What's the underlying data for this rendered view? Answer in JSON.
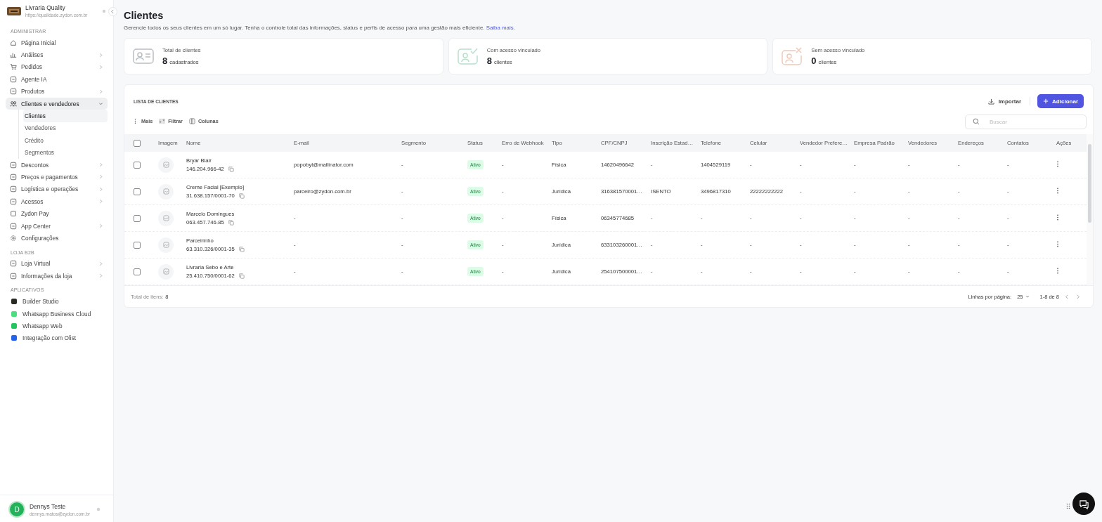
{
  "store": {
    "name": "Livraria Quality",
    "url": "https://qualidade.zydon.com.br"
  },
  "sidebar": {
    "sections": [
      {
        "title": "ADMINISTRAR",
        "items": [
          {
            "kind": "nav",
            "label": "Página Inicial",
            "has_submenu": false
          },
          {
            "kind": "nav",
            "label": "Análises",
            "has_submenu": true,
            "expanded": false
          },
          {
            "kind": "nav",
            "label": "Pedidos",
            "has_submenu": true,
            "expanded": false
          },
          {
            "kind": "nav",
            "label": "Agente IA",
            "has_submenu": false
          },
          {
            "kind": "nav",
            "label": "Produtos",
            "has_submenu": true,
            "expanded": false
          },
          {
            "kind": "nav",
            "label": "Clientes e vendedores",
            "has_submenu": true,
            "expanded": true,
            "selected": true,
            "children": [
              {
                "label": "Clientes",
                "selected": true
              },
              {
                "label": "Vendedores",
                "selected": false
              },
              {
                "label": "Crédito",
                "selected": false
              },
              {
                "label": "Segmentos",
                "selected": false
              }
            ]
          },
          {
            "kind": "nav",
            "label": "Descontos",
            "has_submenu": true,
            "expanded": false
          },
          {
            "kind": "nav",
            "label": "Preços e pagamentos",
            "has_submenu": true,
            "expanded": false
          },
          {
            "kind": "nav",
            "label": "Logística e operações",
            "has_submenu": true,
            "expanded": false
          },
          {
            "kind": "nav",
            "label": "Acessos",
            "has_submenu": true,
            "expanded": false
          },
          {
            "kind": "nav",
            "label": "Zydon Pay",
            "has_submenu": false
          },
          {
            "kind": "nav",
            "label": "App Center",
            "has_submenu": true,
            "expanded": false
          },
          {
            "kind": "nav",
            "label": "Configurações",
            "has_submenu": false
          }
        ]
      },
      {
        "title": "LOJA B2B",
        "items": [
          {
            "kind": "nav",
            "label": "Loja Virtual",
            "has_submenu": true,
            "expanded": false
          },
          {
            "kind": "nav",
            "label": "Informações da loja",
            "has_submenu": true,
            "expanded": false
          }
        ]
      },
      {
        "title": "APLICATIVOS",
        "items": [
          {
            "kind": "app",
            "label": "Builder Studio",
            "color": "#2b2a22"
          },
          {
            "kind": "app",
            "label": "Whatsapp Business Cloud",
            "color": "#4ade80"
          },
          {
            "kind": "app",
            "label": "Whatsapp Web",
            "color": "#22c55e"
          },
          {
            "kind": "app",
            "label": "Integração com Olist",
            "color": "#2563eb"
          }
        ]
      }
    ]
  },
  "user": {
    "initial": "D",
    "name": "Dennys Teste",
    "email": "dennys.matos@zydon.com.br"
  },
  "page": {
    "title": "Clientes",
    "description": "Gerencie todos os seus clientes em um só lugar. Tenha o controle total das informações, status e perfis de acesso para uma gestão mais eficiente.",
    "link": "Saiba mais."
  },
  "stats": [
    {
      "kind": "total",
      "label": "Total de clientes",
      "value": "8",
      "unit": "cadastrados"
    },
    {
      "kind": "linked",
      "label": "Com acesso vinculado",
      "value": "8",
      "unit": "clientes"
    },
    {
      "kind": "unlinked",
      "label": "Sem acesso vinculado",
      "value": "0",
      "unit": "clientes"
    }
  ],
  "list": {
    "title": "LISTA DE CLIENTES",
    "select_all_checked": false,
    "import_button": "Importar",
    "add_button": "Adicionar",
    "toolbar": [
      "Mais",
      "Filtrar",
      "Colunas"
    ],
    "search": {
      "placeholder": "Buscar"
    },
    "columns": [
      "Imagem",
      "Nome",
      "E-mail",
      "Segmento",
      "Status",
      "Erro de Webhook",
      "Tipo",
      "CPF/CNPJ",
      "Inscrição Estad…",
      "Telefone",
      "Celular",
      "Vendedor Prefere…",
      "Empresa Padrão",
      "Vendedores",
      "Endereços",
      "Contatos",
      "Ações"
    ],
    "rows": [
      {
        "checked": false,
        "name": "Bryar Blair",
        "document": "146.204.966-42",
        "email": "popobyt@mailinator.com",
        "segment": "-",
        "status": "Ativo",
        "webhook_error": "-",
        "type": "Física",
        "cpf_cnpj": "14620496642",
        "state_registration": "-",
        "phone": "1404529119",
        "mobile": "-",
        "preferred_seller": "-",
        "default_company": "-",
        "sellers": "-",
        "addresses": "-",
        "contacts": "-"
      },
      {
        "checked": false,
        "name": "Creme Facial [Exemplo]",
        "document": "31.638.157/0001-70",
        "email": "parceiro@zydon.com.br",
        "segment": "-",
        "status": "Ativo",
        "webhook_error": "-",
        "type": "Jurídica",
        "cpf_cnpj": "316381570001…",
        "state_registration": "ISENTO",
        "phone": "3496817310",
        "mobile": "22222222222",
        "preferred_seller": "-",
        "default_company": "-",
        "sellers": "-",
        "addresses": "-",
        "contacts": "-"
      },
      {
        "checked": false,
        "name": "Marcelo Domingues",
        "document": "063.457.746-85",
        "email": "-",
        "segment": "-",
        "status": "Ativo",
        "webhook_error": "-",
        "type": "Física",
        "cpf_cnpj": "06345774685",
        "state_registration": "-",
        "phone": "-",
        "mobile": "-",
        "preferred_seller": "-",
        "default_company": "-",
        "sellers": "-",
        "addresses": "-",
        "contacts": "-"
      },
      {
        "checked": false,
        "name": "Parceirinho",
        "document": "63.310.326/0001-35",
        "email": "-",
        "segment": "-",
        "status": "Ativo",
        "webhook_error": "-",
        "type": "Jurídica",
        "cpf_cnpj": "633103260001…",
        "state_registration": "-",
        "phone": "-",
        "mobile": "-",
        "preferred_seller": "-",
        "default_company": "-",
        "sellers": "-",
        "addresses": "-",
        "contacts": "-"
      },
      {
        "checked": false,
        "name": "Livraria Sebo e Arte",
        "document": "25.410.750/0001-62",
        "email": "-",
        "segment": "-",
        "status": "Ativo",
        "webhook_error": "-",
        "type": "Jurídica",
        "cpf_cnpj": "254107500001…",
        "state_registration": "-",
        "phone": "-",
        "mobile": "-",
        "preferred_seller": "-",
        "default_company": "-",
        "sellers": "-",
        "addresses": "-",
        "contacts": "-"
      }
    ],
    "footer": {
      "total_label": "Total de itens:",
      "total_value": "8",
      "rows_per_page_label": "Linhas por página:",
      "rows_per_page": "25",
      "range": "1-8 de 8"
    }
  }
}
